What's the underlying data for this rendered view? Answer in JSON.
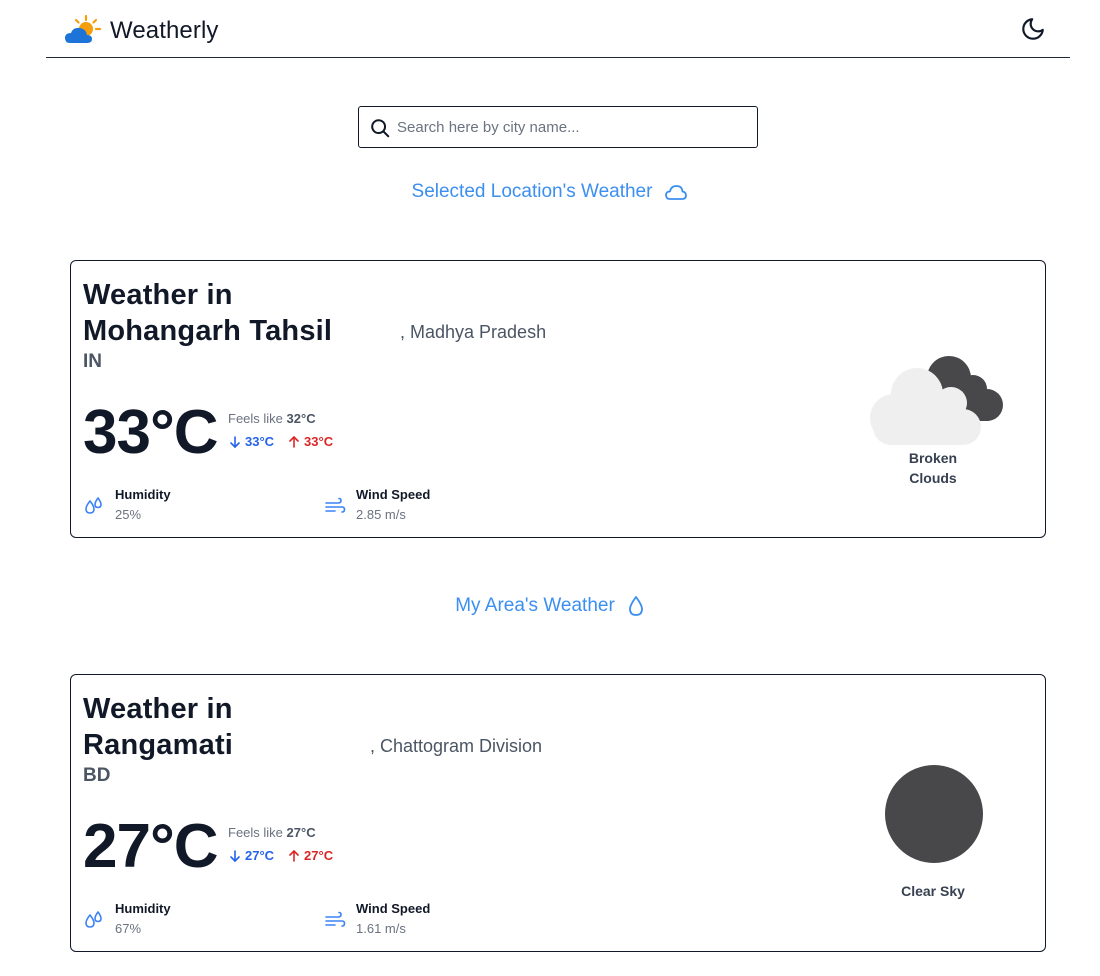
{
  "header": {
    "brand": "Weatherly"
  },
  "search": {
    "placeholder": "Search here by city name...",
    "value": ""
  },
  "sections": {
    "selected_title": "Selected Location's Weather",
    "my_area_title": "My Area's Weather"
  },
  "selected": {
    "title_line1": "Weather in",
    "city": "Mohangarh Tahsil",
    "region": ", Madhya Pradesh",
    "country": "IN",
    "temp": "33°C",
    "feels_label": "Feels like",
    "feels_value": "32°C",
    "min": "33°C",
    "max": "33°C",
    "humidity_label": "Humidity",
    "humidity_value": "25%",
    "wind_label": "Wind Speed",
    "wind_value": "2.85 m/s",
    "condition_line1": "Broken",
    "condition_line2": "Clouds",
    "condition_icon": "broken-clouds-icon"
  },
  "my_area": {
    "title_line1": "Weather in",
    "city": "Rangamati",
    "region": ", Chattogram Division",
    "country": "BD",
    "temp": "27°C",
    "feels_label": "Feels like",
    "feels_value": "27°C",
    "min": "27°C",
    "max": "27°C",
    "humidity_label": "Humidity",
    "humidity_value": "67%",
    "wind_label": "Wind Speed",
    "wind_value": "1.61 m/s",
    "condition_line1": "Clear Sky",
    "condition_icon": "clear-sky-icon"
  },
  "colors": {
    "accent": "#3b8ff0",
    "min_temp": "#2563eb",
    "max_temp": "#dc2626",
    "text_dark": "#111827",
    "icon_dark": "#48484a",
    "cloud_light": "#efefef"
  }
}
